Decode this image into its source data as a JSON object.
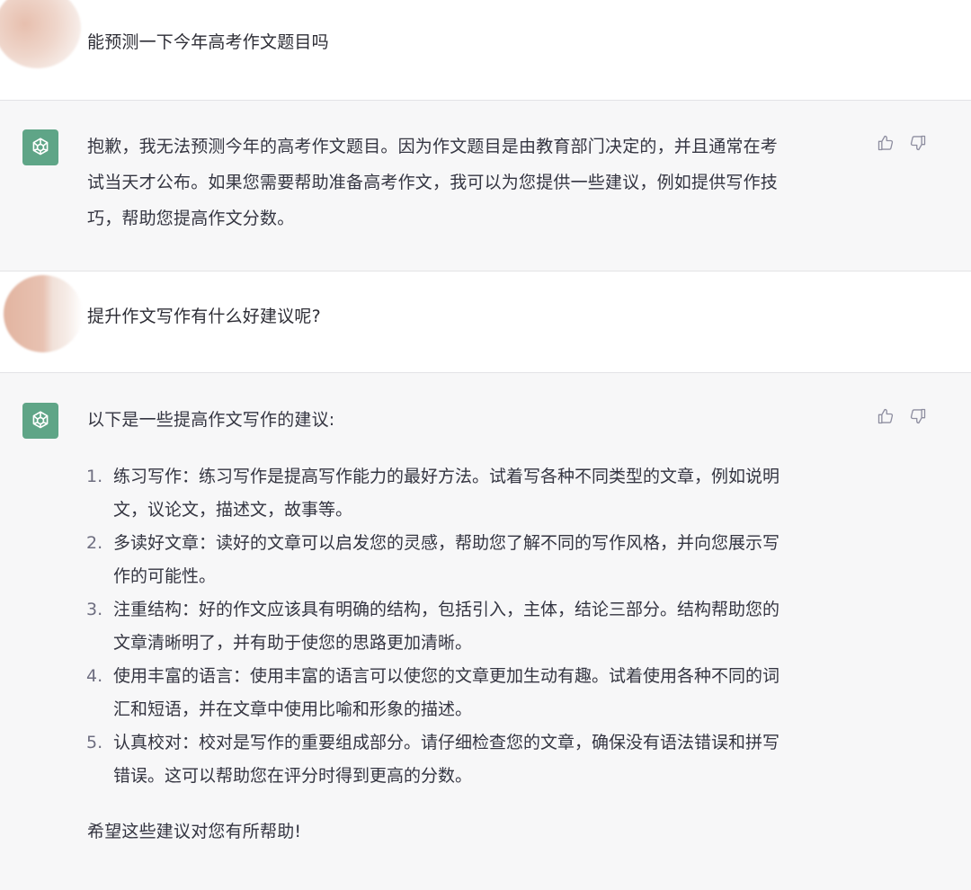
{
  "conversation": {
    "m1": {
      "text": "能预测一下今年高考作文题目吗"
    },
    "m2": {
      "lines": [
        "抱歉，我无法预测今年的高考作文题目。因为作文题目是由教育部门决定的，并且通常在考",
        "试当天才公布。如果您需要帮助准备高考作文，我可以为您提供一些建议，例如提供写作技",
        "巧，帮助您提高作文分数。"
      ]
    },
    "m3": {
      "text": "提升作文写作有什么好建议呢?"
    },
    "m4": {
      "intro": "以下是一些提高作文写作的建议:",
      "items": [
        {
          "num": "1.",
          "line1": "练习写作：练习写作是提高写作能力的最好方法。试着写各种不同类型的文章，例如说明",
          "line2": "文，议论文，描述文，故事等。"
        },
        {
          "num": "2.",
          "line1": "多读好文章：读好的文章可以启发您的灵感，帮助您了解不同的写作风格，并向您展示写",
          "line2": "作的可能性。"
        },
        {
          "num": "3.",
          "line1": "注重结构：好的作文应该具有明确的结构，包括引入，主体，结论三部分。结构帮助您的",
          "line2": "文章清晰明了，并有助于使您的思路更加清晰。"
        },
        {
          "num": "4.",
          "line1": "使用丰富的语言：使用丰富的语言可以使您的文章更加生动有趣。试着使用各种不同的词",
          "line2": "汇和短语，并在文章中使用比喻和形象的描述。"
        },
        {
          "num": "5.",
          "line1": "认真校对：校对是写作的重要组成部分。请仔细检查您的文章，确保没有语法错误和拼写",
          "line2": "错误。这可以帮助您在评分时得到更高的分数。"
        }
      ],
      "outro": "希望这些建议对您有所帮助!"
    }
  },
  "icons": {
    "assistant_avatar": "openai-logo-icon",
    "like": "thumbs-up-icon",
    "dislike": "thumbs-down-icon"
  },
  "colors": {
    "assistant_bg": "#f7f7f8",
    "avatar_green": "#5fa587",
    "text": "#343541"
  }
}
